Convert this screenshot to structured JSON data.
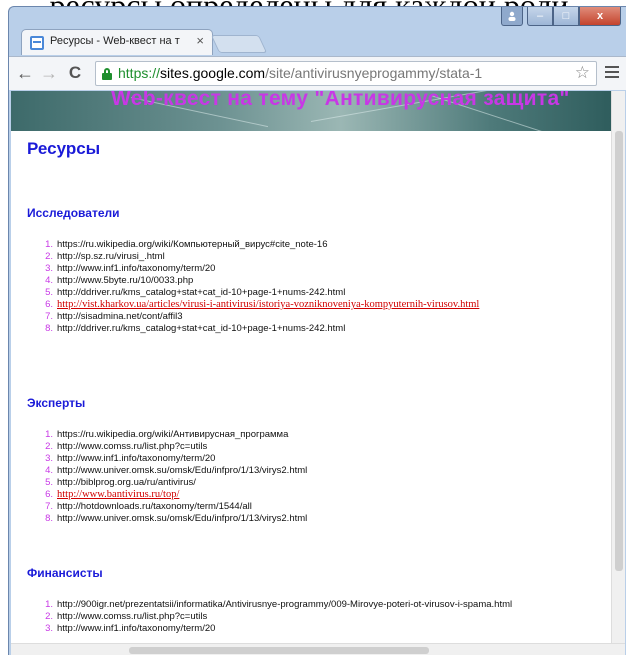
{
  "doc_cut_text": "ресурсы определены для каждой роли.",
  "browser": {
    "tab_title": "Ресурсы - Web-квест на т",
    "tab_close": "×",
    "url_scheme": "https://",
    "url_host": "sites.google.com",
    "url_path": "/site/antivirusnyeprogammy/stata-1",
    "win_min": "–",
    "win_max": "□",
    "win_close": "x"
  },
  "site": {
    "banner_title": "Web-квест на тему \"Антивирусная защита\"",
    "page_title": "Ресурсы"
  },
  "sections": [
    {
      "heading": "Исследователи",
      "items": [
        {
          "num": "1.",
          "text": "https://ru.wikipedia.org/wiki/Компьютерный_вирус#cite_note-16",
          "link": false
        },
        {
          "num": "2.",
          "text": "http://sp.sz.ru/virusi_.html",
          "link": false
        },
        {
          "num": "3.",
          "text": "http://www.inf1.info/taxonomy/term/20",
          "link": false
        },
        {
          "num": "4.",
          "text": "http://www.5byte.ru/10/0033.php",
          "link": false
        },
        {
          "num": "5.",
          "text": "http://ddriver.ru/kms_catalog+stat+cat_id-10+page-1+nums-242.html",
          "link": false
        },
        {
          "num": "6.",
          "text": "http://vist.kharkov.ua/articles/virusi-i-antivirusi/istoriya-vozniknoveniya-kompyuternih-virusov.html",
          "link": true
        },
        {
          "num": "7.",
          "text": "http://sisadmina.net/cont/affil3",
          "link": false
        },
        {
          "num": "8.",
          "text": "http://ddriver.ru/kms_catalog+stat+cat_id-10+page-1+nums-242.html",
          "link": false
        }
      ]
    },
    {
      "heading": "Эксперты",
      "items": [
        {
          "num": "1.",
          "text": "https://ru.wikipedia.org/wiki/Антивирусная_программа",
          "link": false
        },
        {
          "num": "2.",
          "text": "http://www.comss.ru/list.php?c=utils",
          "link": false
        },
        {
          "num": "3.",
          "text": "http://www.inf1.info/taxonomy/term/20",
          "link": false
        },
        {
          "num": "4.",
          "text": "http://www.univer.omsk.su/omsk/Edu/infpro/1/13/virys2.html",
          "link": false
        },
        {
          "num": "5.",
          "text": "http://biblprog.org.ua/ru/antivirus/",
          "link": false
        },
        {
          "num": "6.",
          "text": "http://www.bantivirus.ru/top/",
          "link": true
        },
        {
          "num": "7.",
          "text": "http://hotdownloads.ru/taxonomy/term/1544/all",
          "link": false
        },
        {
          "num": "8.",
          "text": "http://www.univer.omsk.su/omsk/Edu/infpro/1/13/virys2.html",
          "link": false
        }
      ]
    },
    {
      "heading": "Финансисты",
      "items": [
        {
          "num": "1.",
          "text": "http://900igr.net/prezentatsii/informatika/Antivirusnye-programmy/009-Mirovye-poteri-ot-virusov-i-spama.html",
          "link": false
        },
        {
          "num": "2.",
          "text": "http://www.comss.ru/list.php?c=utils",
          "link": false
        },
        {
          "num": "3.",
          "text": "http://www.inf1.info/taxonomy/term/20",
          "link": false
        }
      ]
    }
  ],
  "colors": {
    "heading": "#1a1ad8",
    "banner_title": "#c837e6",
    "list_number": "#c837e6",
    "link": "#d00000",
    "url_scheme": "#1f8f2e"
  },
  "icons": [
    "back-arrow-icon",
    "forward-arrow-icon",
    "reload-icon",
    "lock-icon",
    "star-icon",
    "menu-icon",
    "favicon-icon",
    "close-icon"
  ]
}
